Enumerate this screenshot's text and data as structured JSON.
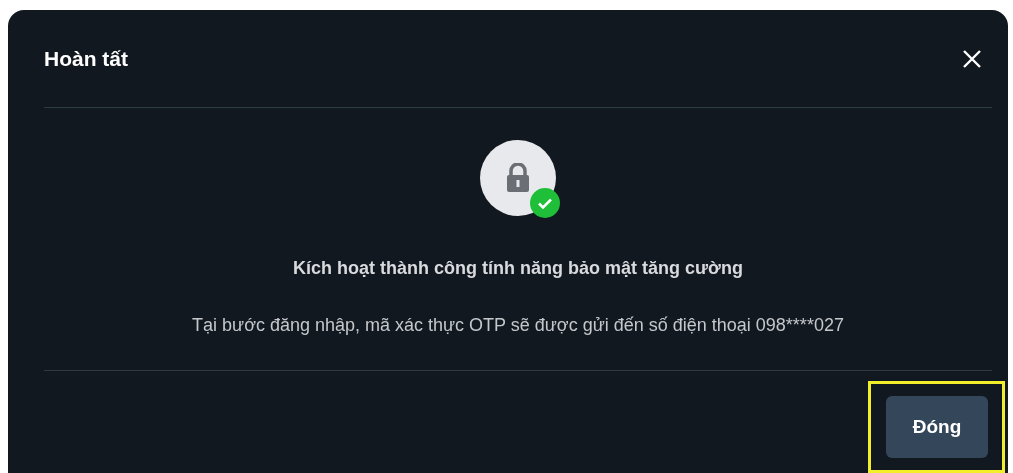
{
  "dialog": {
    "title": "Hoàn tất",
    "message_title": "Kích hoạt thành công tính năng bảo mật tăng cường",
    "message": "Tại bước đăng nhập, mã xác thực OTP sẽ được gửi đến số điện thoại 098****027"
  },
  "buttons": [
    {
      "label": "Đóng",
      "highlighted": true
    }
  ]
}
